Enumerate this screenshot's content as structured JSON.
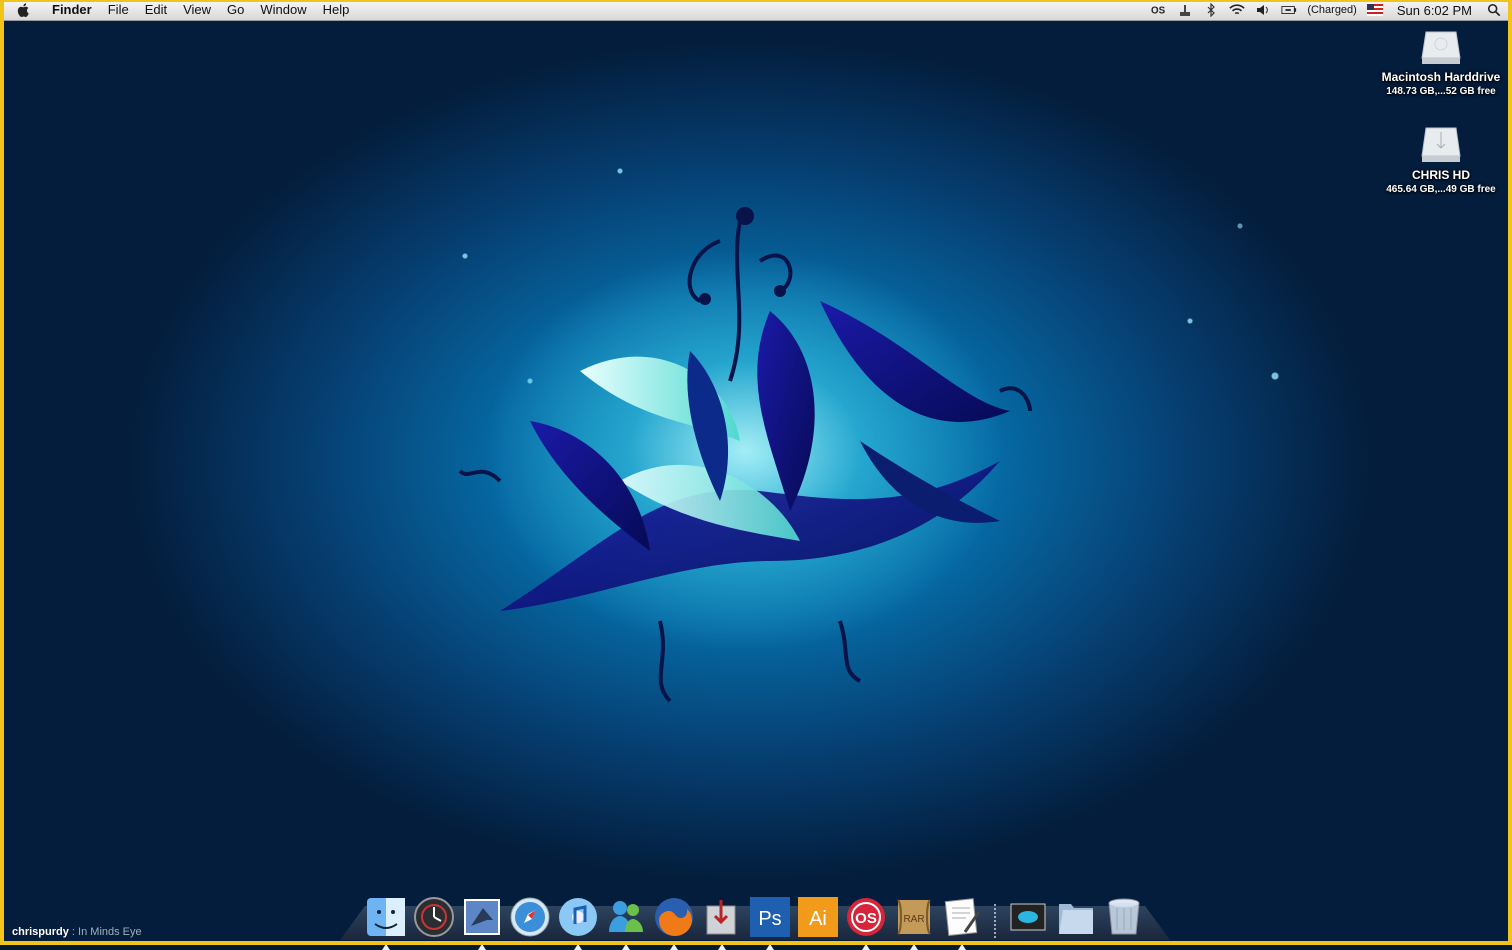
{
  "menubar": {
    "app_name": "Finder",
    "menus": [
      "File",
      "Edit",
      "View",
      "Go",
      "Window",
      "Help"
    ],
    "status": {
      "battery": "(Charged)",
      "clock": "Sun 6:02 PM",
      "icons": [
        "lastfm-icon",
        "tray-icon",
        "bluetooth-icon",
        "wifi-icon",
        "volume-icon",
        "battery-icon",
        "flag-us-icon",
        "spotlight-icon"
      ]
    }
  },
  "desktop": {
    "icons": [
      {
        "name": "Macintosh Harddrive",
        "info": "148.73 GB,...52 GB free",
        "icon": "hard-drive-icon"
      },
      {
        "name": "CHRIS HD",
        "info": "465.64 GB,...49 GB free",
        "icon": "usb-drive-icon"
      }
    ],
    "credit": {
      "author": "chrispurdy",
      "title": "In Minds Eye"
    }
  },
  "dock": {
    "items": [
      {
        "name": "Finder",
        "icon": "finder-icon",
        "running": true
      },
      {
        "name": "Time Machine",
        "icon": "time-machine-icon",
        "running": false
      },
      {
        "name": "Mail",
        "icon": "mail-icon",
        "running": true
      },
      {
        "name": "Safari",
        "icon": "safari-icon",
        "running": false
      },
      {
        "name": "iTunes",
        "icon": "itunes-icon",
        "running": true
      },
      {
        "name": "Messenger",
        "icon": "messenger-icon",
        "running": true
      },
      {
        "name": "Firefox",
        "icon": "firefox-icon",
        "running": true
      },
      {
        "name": "Installer",
        "icon": "installer-icon",
        "running": true
      },
      {
        "name": "Photoshop",
        "icon": "photoshop-icon",
        "running": true,
        "label": "Ps"
      },
      {
        "name": "Illustrator",
        "icon": "illustrator-icon",
        "running": false,
        "label": "Ai"
      },
      {
        "name": "Last.fm",
        "icon": "lastfm-app-icon",
        "running": true
      },
      {
        "name": "Archive",
        "icon": "rar-icon",
        "running": true,
        "label": "RAR"
      },
      {
        "name": "TextEdit",
        "icon": "textedit-icon",
        "running": true
      },
      {
        "name": "Preview Stack",
        "icon": "stack-photo-icon",
        "running": false
      },
      {
        "name": "Documents",
        "icon": "folder-icon",
        "running": false
      },
      {
        "name": "Trash",
        "icon": "trash-icon",
        "running": false
      }
    ]
  },
  "colors": {
    "frame": "#f2c318",
    "accent": "#0a8ec0"
  }
}
